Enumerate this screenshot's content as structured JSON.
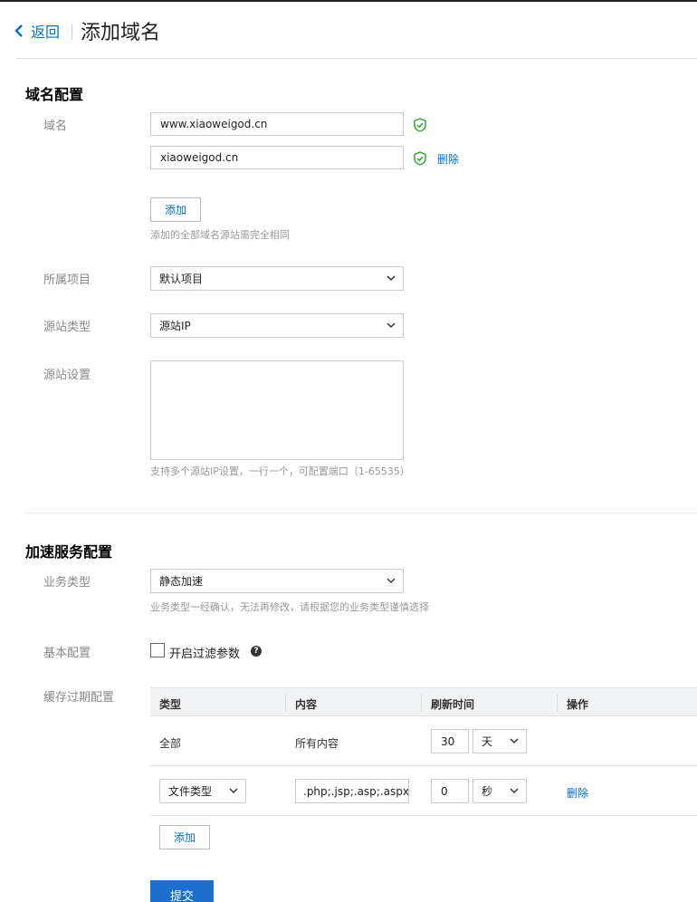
{
  "header": {
    "back_label": "返回",
    "title": "添加域名"
  },
  "domain_section": {
    "title": "域名配置",
    "domain_label": "域名",
    "domains": [
      "www.xiaoweigod.cn",
      "xiaoweigod.cn"
    ],
    "delete_label": "删除",
    "add_label": "添加",
    "add_hint": "添加的全部域名源站需完全相同",
    "project_label": "所属项目",
    "project_value": "默认项目",
    "origin_type_label": "源站类型",
    "origin_type_value": "源站IP",
    "origin_settings_label": "源站设置",
    "origin_settings_value": "",
    "origin_hint": "支持多个源站IP设置，一行一个，可配置端口（1-65535）"
  },
  "accel_section": {
    "title": "加速服务配置",
    "business_type_label": "业务类型",
    "business_type_value": "静态加速",
    "business_hint": "业务类型一经确认，无法再修改，请根据您的业务类型谨慎选择",
    "basic_label": "基本配置",
    "filter_param_label": "开启过滤参数",
    "help_glyph": "?",
    "cache_label": "缓存过期配置",
    "cache_table": {
      "headers": [
        "类型",
        "内容",
        "刷新时间",
        "操作"
      ],
      "rows": [
        {
          "type": "全部",
          "content": "所有内容",
          "time": "30",
          "unit": "天",
          "action": ""
        },
        {
          "type": "文件类型",
          "content": ".php;.jsp;.asp;.aspx",
          "time": "0",
          "unit": "秒",
          "action": "删除"
        }
      ],
      "add_label": "添加"
    },
    "submit_label": "提交"
  },
  "colors": {
    "accent": "#0071ce",
    "success": "#2aa52a",
    "primary_button": "#1d6fce"
  }
}
